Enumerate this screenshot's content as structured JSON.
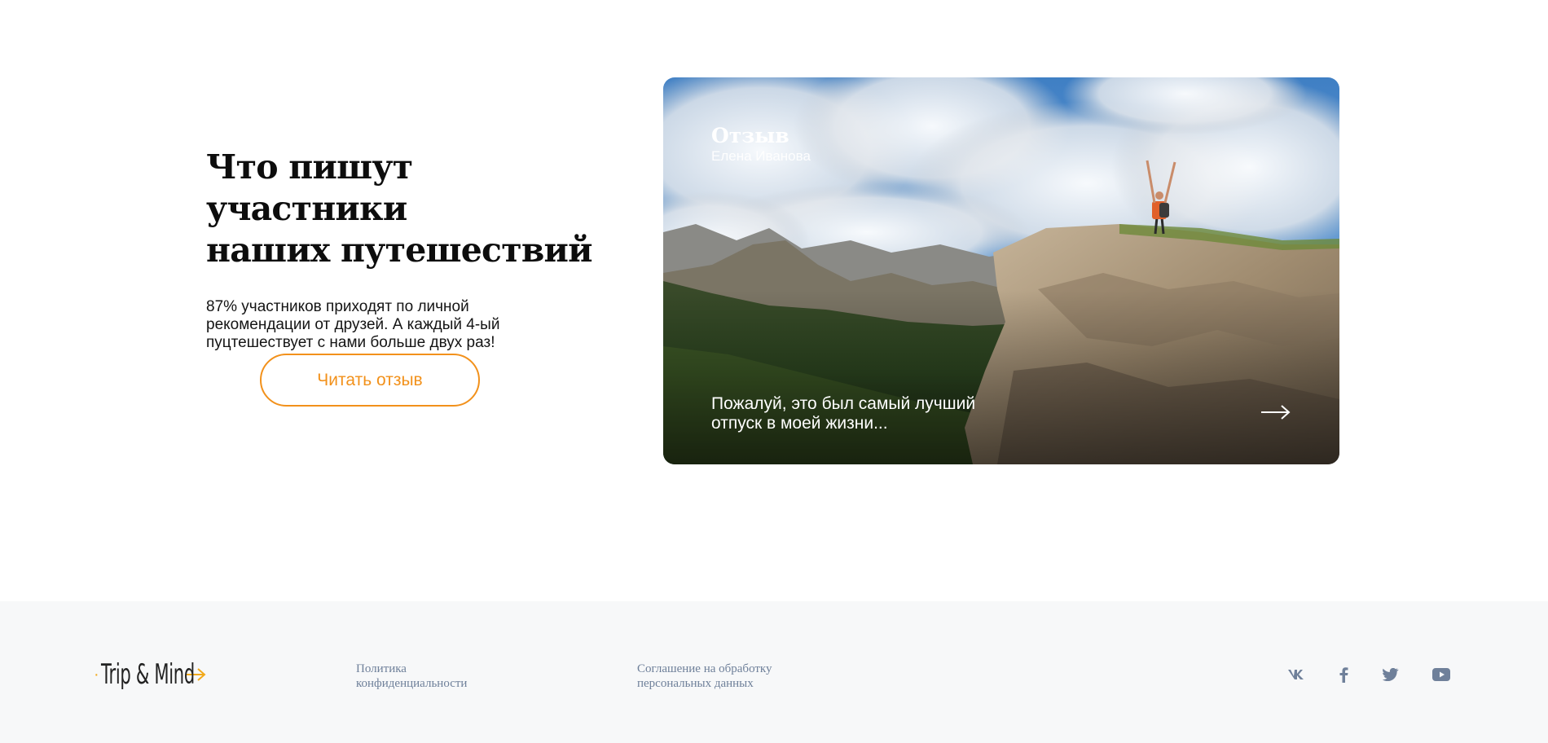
{
  "reviews": {
    "heading_line1": "Что пишут участники",
    "heading_line2": "наших путешествий",
    "description": "87% участников приходят по личной рекомендации от друзей. А каждый 4-ый пуцтешествует с нами больше двух раз!",
    "button_label": "Читать отзыв",
    "card": {
      "title": "Отзыв",
      "author": "Елена Иванова",
      "quote": "Пожалуй, это был самый лучший отпуск в моей жизни...",
      "arrow_icon": "arrow-right-icon"
    },
    "accent_color": "#f2911b"
  },
  "footer": {
    "logo_text": "Trip & Mind",
    "logo_accent_color": "#f2a91b",
    "links": {
      "privacy": "Политика конфиденциальности",
      "agreement": "Соглашение на обработку персональных данных"
    },
    "social": [
      "vk-icon",
      "facebook-icon",
      "twitter-icon",
      "youtube-icon"
    ],
    "link_color": "#6f809a"
  }
}
